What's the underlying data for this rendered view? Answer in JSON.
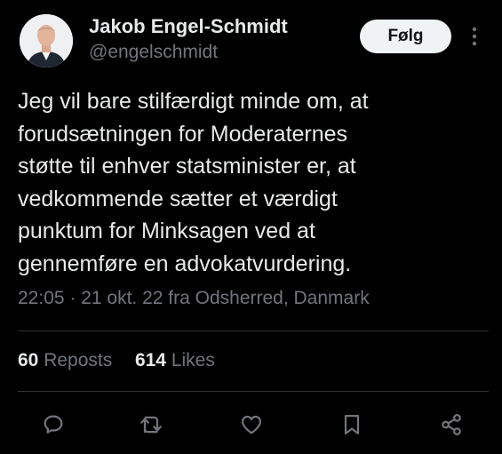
{
  "author": {
    "name": "Jakob Engel-Schmidt",
    "handle": "@engelschmidt"
  },
  "follow_button": {
    "label": "Følg"
  },
  "tweet": {
    "text": "Jeg vil bare stilfærdigt minde om, at\nforudsætningen for Moderaternes\nstøtte til enhver statsminister er, at\nvedkommende sætter et værdigt\npunktum for Minksagen ved at\ngennemføre en advokatvurdering.",
    "timestamp": "22:05 · 21 okt. 22 fra Odsherred, Danmark"
  },
  "stats": {
    "reposts_count": "60",
    "reposts_label": "Reposts",
    "likes_count": "614",
    "likes_label": "Likes"
  },
  "actions": {
    "reply": "reply-icon",
    "repost": "repost-icon",
    "like": "heart-icon",
    "bookmark": "bookmark-icon",
    "share": "share-icon"
  },
  "colors": {
    "background": "#000000",
    "text_primary": "#e7e9ea",
    "text_secondary": "#71767b",
    "divider": "#2f3336",
    "follow_bg": "#eff3f4"
  }
}
